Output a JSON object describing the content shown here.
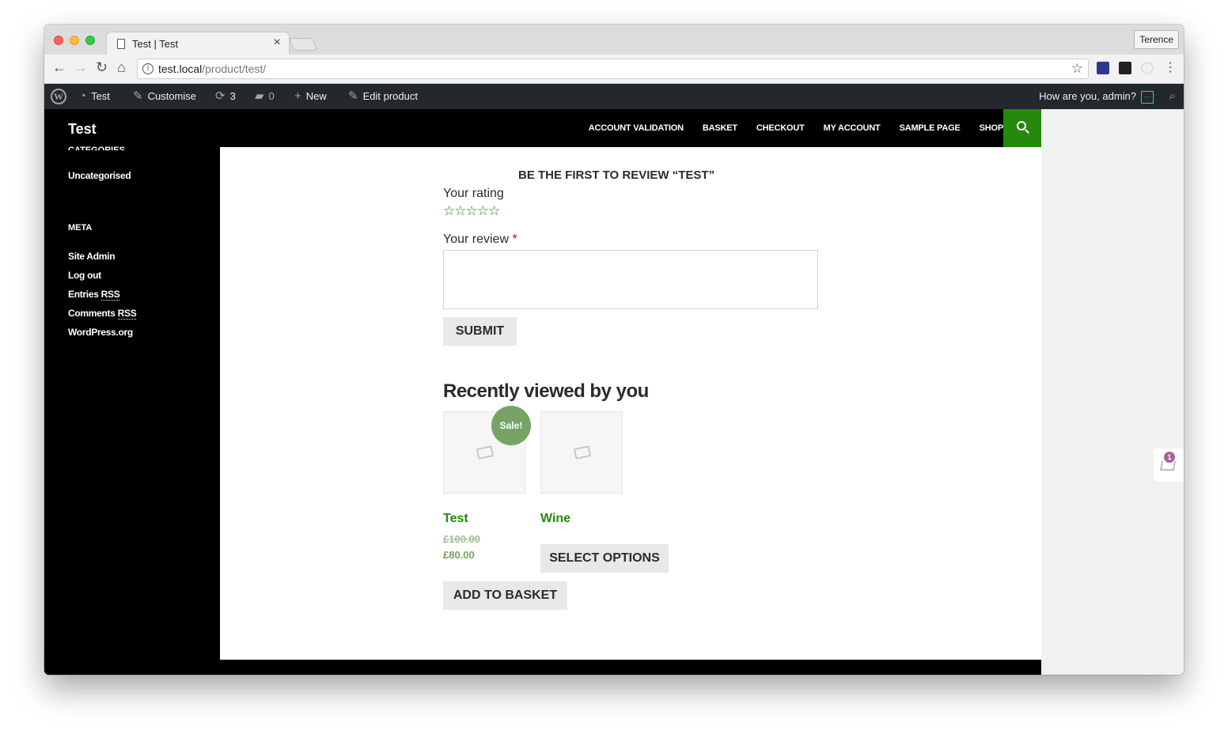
{
  "browser": {
    "tab_title": "Test | Test",
    "tab_close": "×",
    "profile_name": "Terence",
    "url_host": "test.local",
    "url_path": "/product/test/"
  },
  "adminbar": {
    "site_name": "Test",
    "customise": "Customise",
    "updates_count": "3",
    "comments_count": "0",
    "new": "New",
    "edit_product": "Edit product",
    "howdy": "How are you, admin?"
  },
  "site": {
    "title": "Test",
    "nav": [
      "ACCOUNT VALIDATION",
      "BASKET",
      "CHECKOUT",
      "MY ACCOUNT",
      "SAMPLE PAGE",
      "SHOP"
    ]
  },
  "sidebar": {
    "categories_heading": "CATEGORIES",
    "category": "Uncategorised",
    "meta_heading": "META",
    "meta_links": [
      "Site Admin",
      "Log out",
      "Entries",
      "Comments",
      "WordPress.org"
    ],
    "rss": "RSS"
  },
  "review": {
    "title": "BE THE FIRST TO REVIEW “TEST”",
    "rating_label": "Your rating",
    "stars": "☆☆☆☆☆",
    "review_label": "Your review",
    "required_mark": "*",
    "submit": "SUBMIT"
  },
  "recent": {
    "title": "Recently viewed by you",
    "sale_badge": "Sale!",
    "products": [
      {
        "name": "Test",
        "old_price": "£100.00",
        "price": "£80.00",
        "button": "ADD TO BASKET"
      },
      {
        "name": "Wine",
        "button": "SELECT OPTIONS"
      }
    ]
  },
  "cart": {
    "count": "1"
  },
  "colors": {
    "accent": "#24890d",
    "sale": "#77a464",
    "adminbar": "#23282d",
    "badge": "#a46497"
  }
}
